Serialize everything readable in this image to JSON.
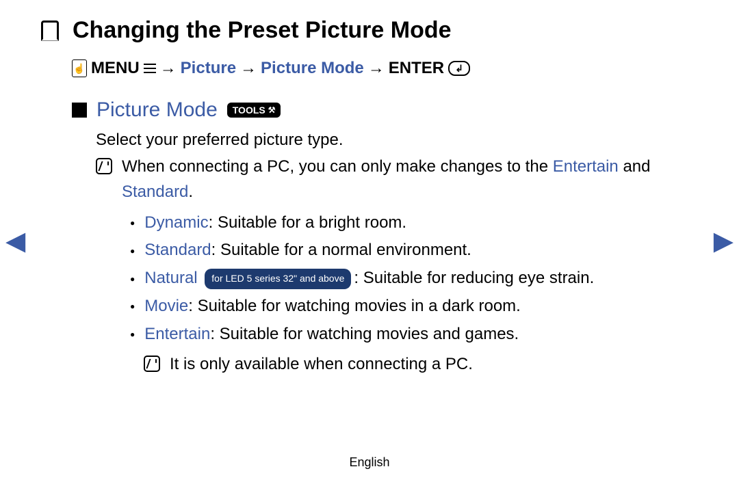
{
  "title": "Changing the Preset Picture Mode",
  "nav": {
    "menu_label": "MENU",
    "arrow": "→",
    "step1": "Picture",
    "step2": "Picture Mode",
    "enter_label": "ENTER"
  },
  "section": {
    "heading": "Picture Mode",
    "tools_label": "TOOLS",
    "intro": "Select your preferred picture type.",
    "note_prefix": "When connecting a PC, you can only make changes to the ",
    "note_link1": "Entertain",
    "note_and": " and ",
    "note_link2": "Standard",
    "note_suffix": "."
  },
  "options": {
    "dynamic": {
      "label": "Dynamic",
      "desc": ": Suitable for a bright room."
    },
    "standard": {
      "label": "Standard",
      "desc": ": Suitable for a normal environment."
    },
    "natural": {
      "label": "Natural",
      "pill": "for LED 5 series 32\" and above",
      "desc": ": Suitable for reducing eye strain."
    },
    "movie": {
      "label": "Movie",
      "desc": ": Suitable for watching movies in a dark room."
    },
    "entertain": {
      "label": "Entertain",
      "desc": ": Suitable for watching movies and games."
    }
  },
  "sub_note": "It is only available when connecting a PC.",
  "footer": "English",
  "arrows": {
    "glyph": "▶"
  }
}
